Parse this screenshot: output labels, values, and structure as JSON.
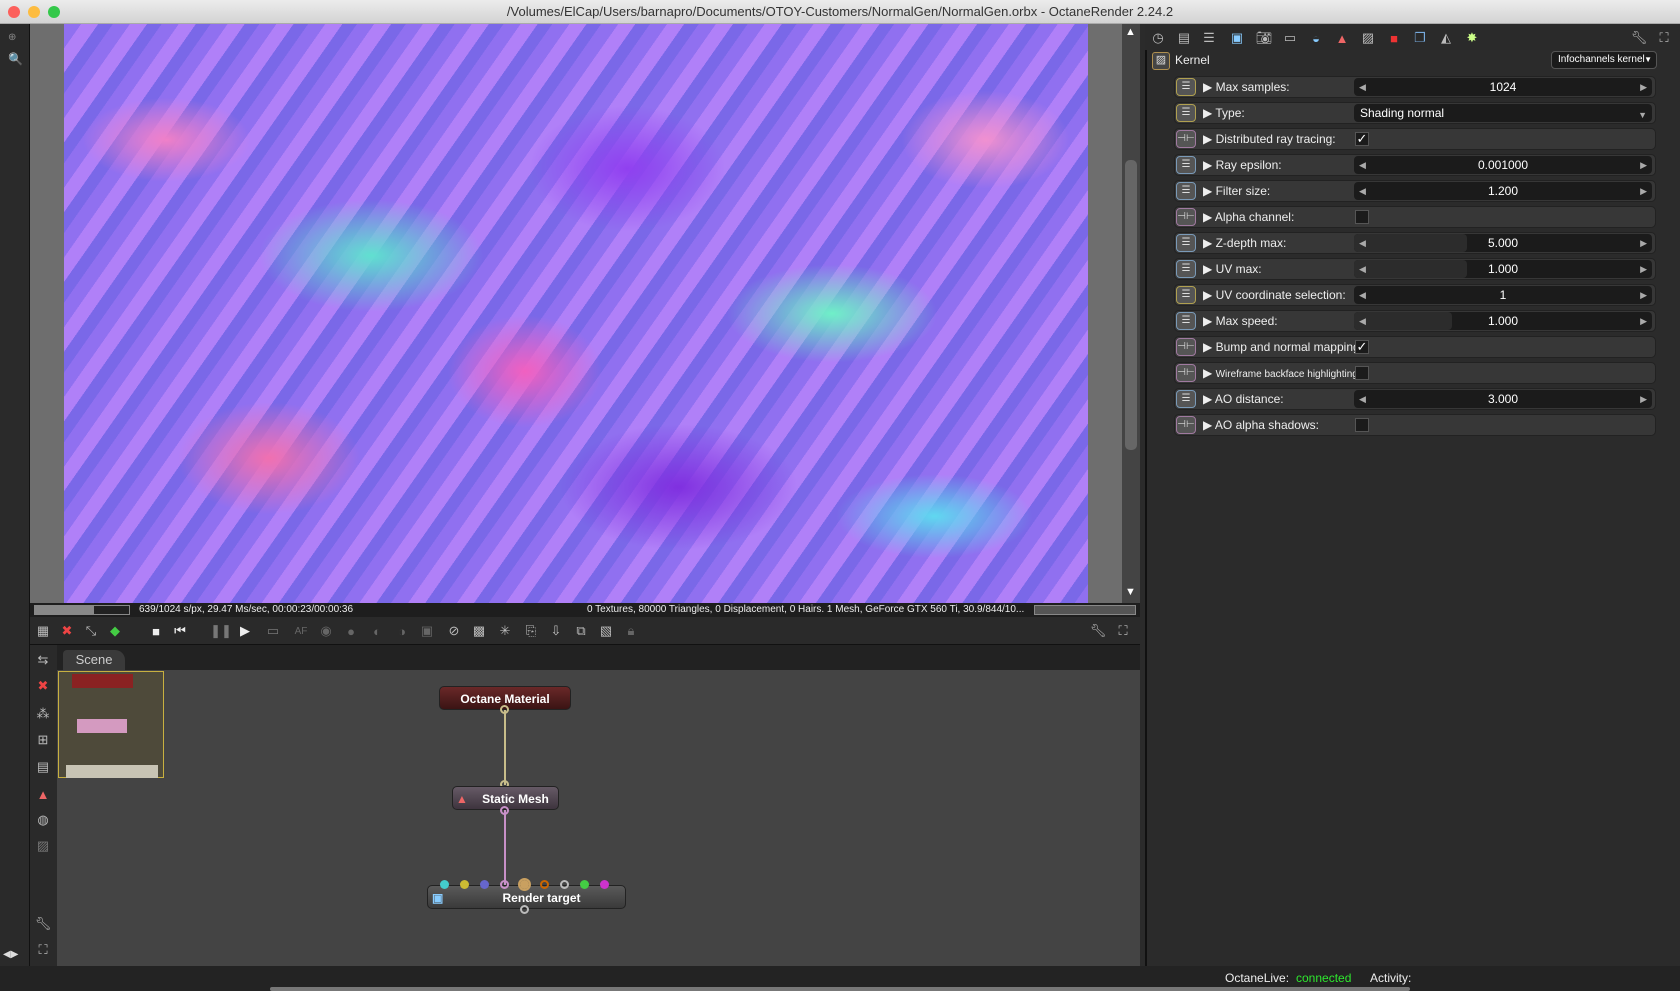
{
  "window": {
    "title": "/Volumes/ElCap/Users/barnapro/Documents/OTOY-Customers/NormalGen/NormalGen.orbx - OctaneRender 2.24.2"
  },
  "viewport": {
    "status_left": "639/1024 s/px, 29.47 Ms/sec, 00:00:23/00:00:36",
    "status_right": "0 Textures, 80000 Triangles, 0 Displacement, 0 Hairs. 1 Mesh, GeForce GTX 560 Ti, 30.9/844/10...",
    "progress": 0.624
  },
  "scene": {
    "tab": "Scene",
    "nodes": {
      "material": "Octane Material",
      "mesh": "Static Mesh",
      "target": "Render target"
    }
  },
  "kernel": {
    "title": "Kernel",
    "kernel_type": "Infochannels kernel",
    "params": [
      {
        "label": "Max samples:",
        "kind": "slider",
        "value": "1024",
        "fill": 0.0
      },
      {
        "label": "Type:",
        "kind": "dropdown",
        "value": "Shading normal"
      },
      {
        "label": "Distributed ray tracing:",
        "kind": "check",
        "checked": true
      },
      {
        "label": "Ray epsilon:",
        "kind": "slider",
        "value": "0.001000",
        "fill": 0.0
      },
      {
        "label": "Filter size:",
        "kind": "slider",
        "value": "1.200",
        "fill": 0.0
      },
      {
        "label": "Alpha channel:",
        "kind": "check",
        "checked": false
      },
      {
        "label": "Z-depth max:",
        "kind": "slider",
        "value": "5.000",
        "fill": 0.38
      },
      {
        "label": "UV max:",
        "kind": "slider",
        "value": "1.000",
        "fill": 0.38
      },
      {
        "label": "UV coordinate selection:",
        "kind": "slider",
        "value": "1",
        "fill": 0.0
      },
      {
        "label": "Max speed:",
        "kind": "slider",
        "value": "1.000",
        "fill": 0.33
      },
      {
        "label": "Bump and normal mapping:",
        "kind": "check",
        "checked": true
      },
      {
        "label": "Wireframe backface highlighting:",
        "kind": "check",
        "checked": false
      },
      {
        "label": "AO distance:",
        "kind": "slider",
        "value": "3.000",
        "fill": 0.0
      },
      {
        "label": "AO alpha shadows:",
        "kind": "check",
        "checked": false
      }
    ]
  },
  "statusbar": {
    "octanelive_label": "OctaneLive:",
    "octanelive_status": "connected",
    "activity_label": "Activity:",
    "connected_color": "#2ee82e"
  }
}
